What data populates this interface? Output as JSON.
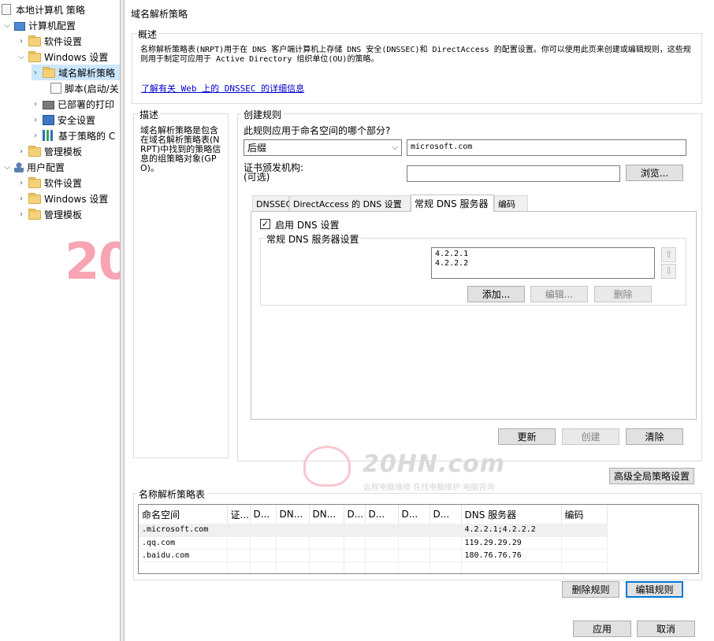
{
  "tree": {
    "root": "本地计算机 策略",
    "computer_config": "计算机配置",
    "software_settings": "软件设置",
    "windows_settings": "Windows 设置",
    "nrpt": "域名解析策略",
    "scripts": "脚本(启动/关",
    "deployed_printers": "已部署的打印",
    "security_settings": "安全设置",
    "policy_based_qos": "基于策略的 C",
    "admin_templates": "管理模板",
    "user_config": "用户配置",
    "user_software": "软件设置",
    "user_windows": "Windows 设置",
    "user_admin": "管理模板"
  },
  "page_title": "域名解析策略",
  "overview": {
    "title": "概述",
    "text": "名称解析策略表(NRPT)用于在 DNS 客户端计算机上存储 DNS 安全(DNSSEC)和 DirectAccess 的配置设置。你可以使用此页来创建或编辑规则，这些规则用于制定可应用于 Active Directory 组织单位(OU)的策略。",
    "link": "了解有关 Web 上的 DNSSEC 的详细信息"
  },
  "description": {
    "title": "描述",
    "text": "域名解析策略是包含在域名解析策略表(NRPT)中找到的策略信息的组策略对象(GPO)。"
  },
  "create_rule": {
    "title": "创建规则",
    "question": "此规则应用于命名空间的哪个部分?",
    "namespace_type": "后缀",
    "namespace_value": "microsoft.com",
    "cert_label": "证书颁发机构:",
    "cert_optional": "(可选)",
    "cert_value": "",
    "browse": "浏览...",
    "tabs": [
      "DNSSEC",
      "DirectAccess 的 DNS 设置",
      "常规 DNS 服务器",
      "编码"
    ],
    "enable_dns": "启用 DNS 设置",
    "dns_group_title": "常规 DNS 服务器设置",
    "dns_servers": [
      "4.2.2.1",
      "4.2.2.2"
    ],
    "add": "添加...",
    "edit": "编辑...",
    "delete": "删除",
    "update": "更新",
    "create": "创建",
    "clear": "清除"
  },
  "advanced_button": "高级全局策略设置",
  "nrpt_table": {
    "title": "名称解析策略表",
    "columns": [
      "命名空间",
      "证...",
      "D...",
      "DN...",
      "DN...",
      "D...",
      "D...",
      "D...",
      "D...",
      "DNS 服务器",
      "编码"
    ],
    "rows": [
      [
        ".microsoft.com",
        "",
        "",
        "",
        "",
        "",
        "",
        "",
        "",
        "4.2.2.1;4.2.2.2",
        ""
      ],
      [
        ".qq.com",
        "",
        "",
        "",
        "",
        "",
        "",
        "",
        "",
        "119.29.29.29",
        ""
      ],
      [
        ".baidu.com",
        "",
        "",
        "",
        "",
        "",
        "",
        "",
        "",
        "180.76.76.76",
        ""
      ]
    ]
  },
  "delete_rule": "删除规则",
  "edit_rule": "编辑规则",
  "apply": "应用",
  "cancel": "取消",
  "watermark": {
    "site": "20HN.com",
    "slogan": "远程电脑维修 在线电脑维护 电脑咨询",
    "logo_number": "20",
    "logo_sub": "HN"
  }
}
